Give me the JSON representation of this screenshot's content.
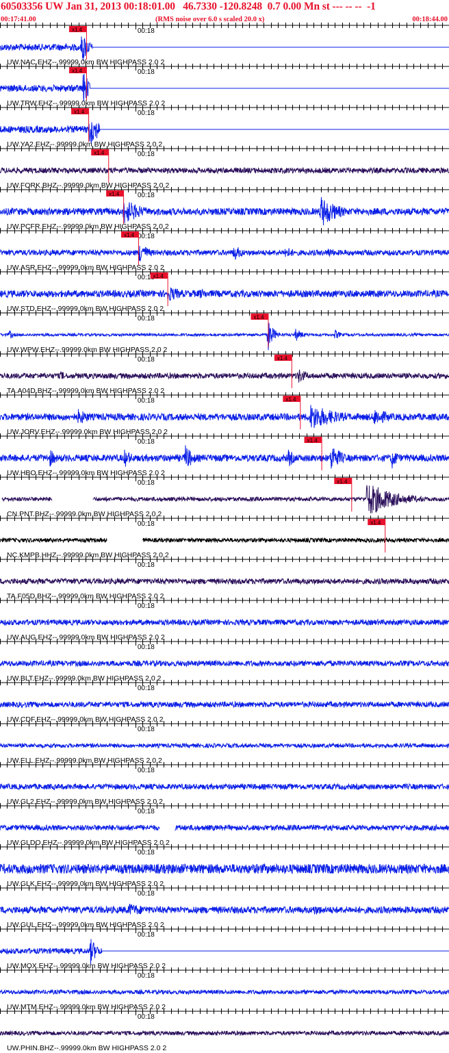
{
  "header": {
    "title": "60503356 UW Jan 31, 2013 00:18:01.00   46.7330 -120.8248  0.7 0.00 Mn st --- -- --  -1",
    "start_time": "00:17:41.00",
    "end_time": "00:18:44.00",
    "noise_note": "(RMS noise over 6.0 s scaled 20.0 x)"
  },
  "colors": {
    "header_text": "#e8112b",
    "trace_blue": "#0a1ee6",
    "trace_purple": "#2a0f5a",
    "trace_black": "#000000",
    "pick": "#e8112b",
    "axis": "#000000"
  },
  "chart_data": {
    "type": "line",
    "x_unit": "time",
    "x_range": [
      "00:17:41.00",
      "00:18:44.00"
    ],
    "time_tick_label": "00:18",
    "pick_label": "x1.4",
    "tick_interval_s": 1,
    "traces": [
      {
        "label": "UW.NAC.EHZ--.99999.0km BW  HIGHPASS  2.0  2",
        "color": "blue",
        "pick_s": 12.0,
        "amp": 5,
        "events": [
          {
            "t": 11.5,
            "a": 26,
            "w": 0.9
          }
        ],
        "flatline_after_s": 13.0
      },
      {
        "label": "UW.TRW.EHZ--.99999.0km BW  HIGHPASS  2.0  2",
        "color": "blue",
        "pick_s": 12.0,
        "amp": 5,
        "events": [
          {
            "t": 11.7,
            "a": 26,
            "w": 0.9
          }
        ],
        "flatline_after_s": 12.6
      },
      {
        "label": "UW.YA2.EHZ--.99999.0km BW  HIGHPASS  2.0  2",
        "color": "blue",
        "pick_s": 12.3,
        "amp": 5,
        "events": [
          {
            "t": 12.6,
            "a": 24,
            "w": 1.6
          }
        ],
        "flatline_after_s": 14.0
      },
      {
        "label": "UW.FORK.BHZ--.99999.0km BW  HIGHPASS  2.0  2",
        "color": "purple",
        "pick_s": 15.1,
        "amp": 4,
        "events": [
          {
            "t": 54.0,
            "a": 5,
            "w": 2.0
          }
        ]
      },
      {
        "label": "UW.PCFR.EHZ--.99999.0km BW  HIGHPASS  2.0  2",
        "color": "blue",
        "pick_s": 17.2,
        "amp": 5,
        "events": [
          {
            "t": 17.4,
            "a": 20,
            "w": 2.5
          },
          {
            "t": 45.0,
            "a": 24,
            "w": 2.5
          }
        ]
      },
      {
        "label": "UW.ASR.EHZ--.99999.0km BW  HIGHPASS  2.0  2",
        "color": "blue",
        "pick_s": 19.3,
        "amp": 4,
        "events": [
          {
            "t": 19.6,
            "a": 18,
            "w": 1.2
          },
          {
            "t": 32.8,
            "a": 12,
            "w": 1.5
          },
          {
            "t": 40.0,
            "a": 10,
            "w": 1.5
          },
          {
            "t": 46.0,
            "a": 8,
            "w": 1.5
          }
        ]
      },
      {
        "label": "UW.STD.EHZ--.99999.0km BW  HIGHPASS  2.0  2",
        "color": "blue",
        "pick_s": 23.4,
        "amp": 5,
        "events": [
          {
            "t": 23.6,
            "a": 12,
            "w": 2.5
          },
          {
            "t": 28.0,
            "a": 8,
            "w": 2.0
          }
        ]
      },
      {
        "label": "UW.WPW.EHZ--.99999.0km BW  HIGHPASS  2.0  2",
        "color": "blue",
        "pick_s": 37.5,
        "amp": 2,
        "events": [
          {
            "t": 37.6,
            "a": 24,
            "w": 0.8
          },
          {
            "t": 41.5,
            "a": 10,
            "w": 1.0
          },
          {
            "t": 47.0,
            "a": 8,
            "w": 0.8
          },
          {
            "t": 1.3,
            "a": 8,
            "w": 0.6
          }
        ]
      },
      {
        "label": "TA.A04D.BHZ--.99999.0km BW  HIGHPASS  2.0  2",
        "color": "purple",
        "pick_s": 40.8,
        "amp": 4,
        "events": [
          {
            "t": 41.8,
            "a": 12,
            "w": 1.5
          },
          {
            "t": 8.5,
            "a": 8,
            "w": 1.0
          }
        ]
      },
      {
        "label": "UW.JORV.EHZ--.99999.0km BW  HIGHPASS  2.0  2",
        "color": "blue",
        "pick_s": 42.0,
        "amp": 5,
        "events": [
          {
            "t": 43.5,
            "a": 20,
            "w": 4.0
          },
          {
            "t": 52.5,
            "a": 14,
            "w": 2.5
          },
          {
            "t": 11.0,
            "a": 12,
            "w": 2.0
          }
        ]
      },
      {
        "label": "UW.HBO.EHZ--.99999.0km BW  HIGHPASS  2.0  2",
        "color": "blue",
        "pick_s": 45.0,
        "amp": 5,
        "events": [
          {
            "t": 46.5,
            "a": 22,
            "w": 1.5
          },
          {
            "t": 26.0,
            "a": 20,
            "w": 1.2
          },
          {
            "t": 17.5,
            "a": 14,
            "w": 1.2
          },
          {
            "t": 7.0,
            "a": 14,
            "w": 1.0
          },
          {
            "t": 40.5,
            "a": 14,
            "w": 1.0
          },
          {
            "t": 55.0,
            "a": 16,
            "w": 1.0
          }
        ]
      },
      {
        "label": "CN.PNT.BHZ--.99999.0km BW  HIGHPASS  2.0  2",
        "color": "purple",
        "pick_s": 49.2,
        "amp": 3,
        "events": [
          {
            "t": 51.5,
            "a": 26,
            "w": 4.0
          }
        ],
        "gaps": [
          [
            0.0,
            0.25
          ],
          [
            7.3,
            13.0
          ]
        ]
      },
      {
        "label": "NC.KMPB.HHZ--.99999.0km BW  HIGHPASS  2.0  2",
        "color": "black",
        "pick_s": 53.9,
        "amp": 3,
        "events": [],
        "gaps": [
          [
            15.0,
            20.0
          ]
        ]
      },
      {
        "label": "TA.F05D.BHZ--.99999.0km BW  HIGHPASS  2.0  2",
        "color": "purple",
        "pick_s": null,
        "amp": 4,
        "events": []
      },
      {
        "label": "UW.AUG.EHZ--.99999.0km BW  HIGHPASS  2.0  2",
        "color": "blue",
        "pick_s": null,
        "amp": 4,
        "events": []
      },
      {
        "label": "UW.BLT.EHZ--.99999.0km BW  HIGHPASS  2.0  2",
        "color": "blue",
        "pick_s": null,
        "amp": 4,
        "events": [
          {
            "t": 8.8,
            "a": 6,
            "w": 0.5
          },
          {
            "t": 25.8,
            "a": 6,
            "w": 0.5
          }
        ]
      },
      {
        "label": "UW.CDF.EHZ--.99999.0km BW  HIGHPASS  2.0  2",
        "color": "blue",
        "pick_s": null,
        "amp": 4,
        "events": []
      },
      {
        "label": "UW.ELL.EHZ--.99999.0km BW  HIGHPASS  2.0  2",
        "color": "blue",
        "pick_s": null,
        "amp": 3,
        "events": []
      },
      {
        "label": "UW.GL2.EHZ--.99999.0km BW  HIGHPASS  2.0  2",
        "color": "blue",
        "pick_s": null,
        "amp": 4,
        "events": []
      },
      {
        "label": "UW.GLDO.EHZ--.99999.0km BW  HIGHPASS  2.0  2",
        "color": "blue",
        "pick_s": null,
        "amp": 4,
        "events": [],
        "gaps": [
          [
            22.4,
            24.5
          ]
        ]
      },
      {
        "label": "UW.GLK.EHZ--.99999.0km BW  HIGHPASS  2.0  2",
        "color": "blue",
        "pick_s": null,
        "amp": 7,
        "events": []
      },
      {
        "label": "UW.GUL.EHZ--.99999.0km BW  HIGHPASS  2.0  2",
        "color": "blue",
        "pick_s": null,
        "amp": 5,
        "events": [
          {
            "t": 18.0,
            "a": 10,
            "w": 4.0
          },
          {
            "t": 44.0,
            "a": 8,
            "w": 3.0
          }
        ]
      },
      {
        "label": "UW.MOX.EHZ--.99999.0km BW  HIGHPASS  2.0  2",
        "color": "blue",
        "pick_s": null,
        "amp": 4,
        "events": [
          {
            "t": 12.7,
            "a": 20,
            "w": 1.0
          }
        ],
        "flatline_after_s": 14.3
      },
      {
        "label": "UW.MTM.EHZ--.99999.0km BW  HIGHPASS  2.0  2",
        "color": "blue",
        "pick_s": null,
        "amp": 3,
        "events": []
      },
      {
        "label": "UW.PHIN.BHZ--.99999.0km BW  HIGHPASS  2.0  2",
        "color": "purple",
        "pick_s": null,
        "amp": 3,
        "events": [
          {
            "t": 12.5,
            "a": 5,
            "w": 0.5
          }
        ]
      }
    ]
  }
}
